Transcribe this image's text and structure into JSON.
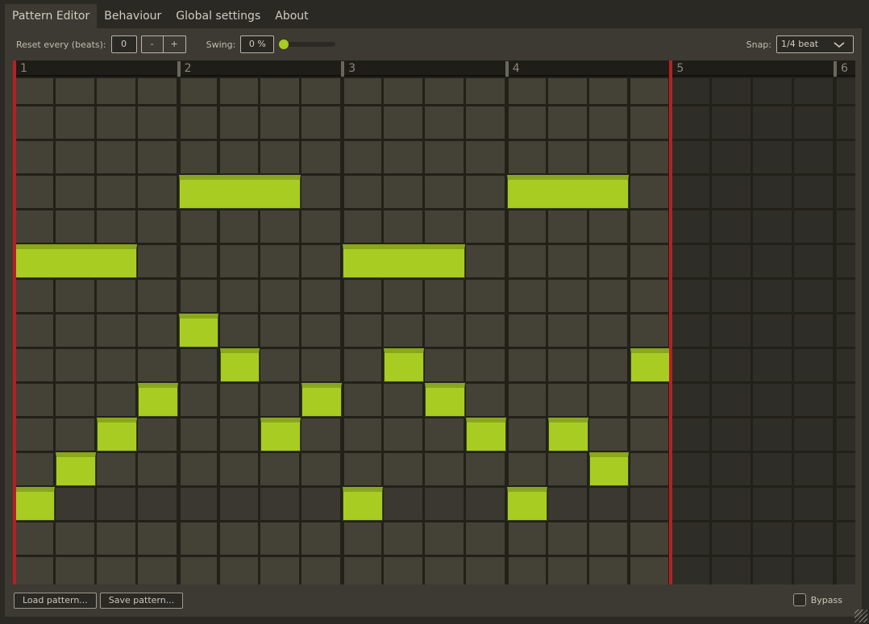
{
  "tabs": [
    {
      "label": "Pattern Editor",
      "active": true
    },
    {
      "label": "Behaviour"
    },
    {
      "label": "Global settings"
    },
    {
      "label": "About"
    }
  ],
  "toolbar": {
    "reset_label": "Reset every (beats):",
    "reset_value": "0",
    "minus": "-",
    "plus": "+",
    "swing_label": "Swing:",
    "swing_value": "0 %",
    "swing_fraction": 0,
    "snap_label": "Snap:",
    "snap_value": "1/4 beat"
  },
  "grid": {
    "beats": [
      "1",
      "2",
      "3",
      "4",
      "5",
      "6"
    ],
    "pattern_length_beats": 4,
    "steps_per_beat": 4,
    "rows": 15,
    "notes": [
      {
        "row": 3,
        "start": 4,
        "length": 3
      },
      {
        "row": 3,
        "start": 12,
        "length": 3
      },
      {
        "row": 5,
        "start": 0,
        "length": 3
      },
      {
        "row": 5,
        "start": 8,
        "length": 3
      },
      {
        "row": 7,
        "start": 4,
        "length": 1
      },
      {
        "row": 8,
        "start": 5,
        "length": 1
      },
      {
        "row": 8,
        "start": 9,
        "length": 1
      },
      {
        "row": 8,
        "start": 15,
        "length": 1
      },
      {
        "row": 9,
        "start": 3,
        "length": 1
      },
      {
        "row": 9,
        "start": 7,
        "length": 1
      },
      {
        "row": 9,
        "start": 10,
        "length": 1
      },
      {
        "row": 10,
        "start": 2,
        "length": 1
      },
      {
        "row": 10,
        "start": 6,
        "length": 1
      },
      {
        "row": 10,
        "start": 11,
        "length": 1
      },
      {
        "row": 10,
        "start": 13,
        "length": 1
      },
      {
        "row": 11,
        "start": 1,
        "length": 1
      },
      {
        "row": 11,
        "start": 14,
        "length": 1
      },
      {
        "row": 12,
        "start": 0,
        "length": 1
      },
      {
        "row": 12,
        "start": 8,
        "length": 1
      },
      {
        "row": 12,
        "start": 12,
        "length": 1
      }
    ]
  },
  "colors": {
    "note": "#a8cc22",
    "marker": "#b22222"
  },
  "footer": {
    "load": "Load pattern...",
    "save": "Save pattern...",
    "bypass": "Bypass",
    "bypass_checked": false
  }
}
